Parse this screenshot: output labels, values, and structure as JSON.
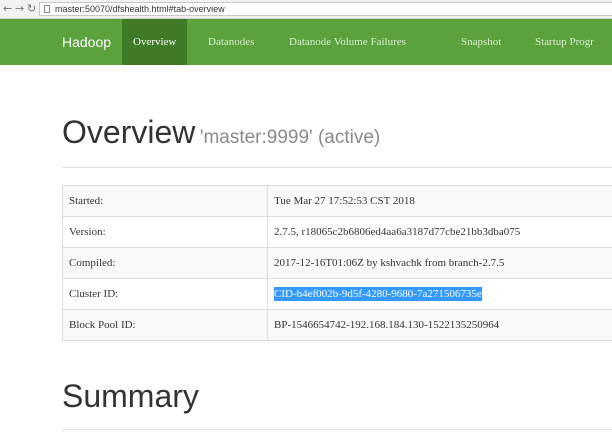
{
  "browser": {
    "back_icon": "back-arrow-icon",
    "forward_icon": "forward-arrow-icon",
    "reload_icon": "reload-icon",
    "url": "master:50070/dfshealth.html#tab-overview"
  },
  "navbar": {
    "brand": "Hadoop",
    "tabs": [
      {
        "label": "Overview",
        "active": true
      },
      {
        "label": "Datanodes"
      },
      {
        "label": "Datanode Volume Failures"
      },
      {
        "label": "Snapshot"
      },
      {
        "label": "Startup Progr"
      }
    ],
    "color": "#5ba13c",
    "active_color": "#3f7a27"
  },
  "overview": {
    "title": "Overview",
    "subtitle": "'master:9999' (active)",
    "rows": [
      {
        "label": "Started:",
        "value": "Tue Mar 27 17:52:53 CST 2018"
      },
      {
        "label": "Version:",
        "value": "2.7.5, r18065c2b6806ed4aa6a3187d77cbe21bb3dba075"
      },
      {
        "label": "Compiled:",
        "value": "2017-12-16T01:06Z by kshvachk from branch-2.7.5"
      },
      {
        "label": "Cluster ID:",
        "value": "CID-b4ef002b-9d5f-4280-9680-7a271506735e",
        "selected": true
      },
      {
        "label": "Block Pool ID:",
        "value": "BP-1546654742-192.168.184.130-1522135250964"
      }
    ]
  },
  "summary": {
    "title": "Summary"
  }
}
